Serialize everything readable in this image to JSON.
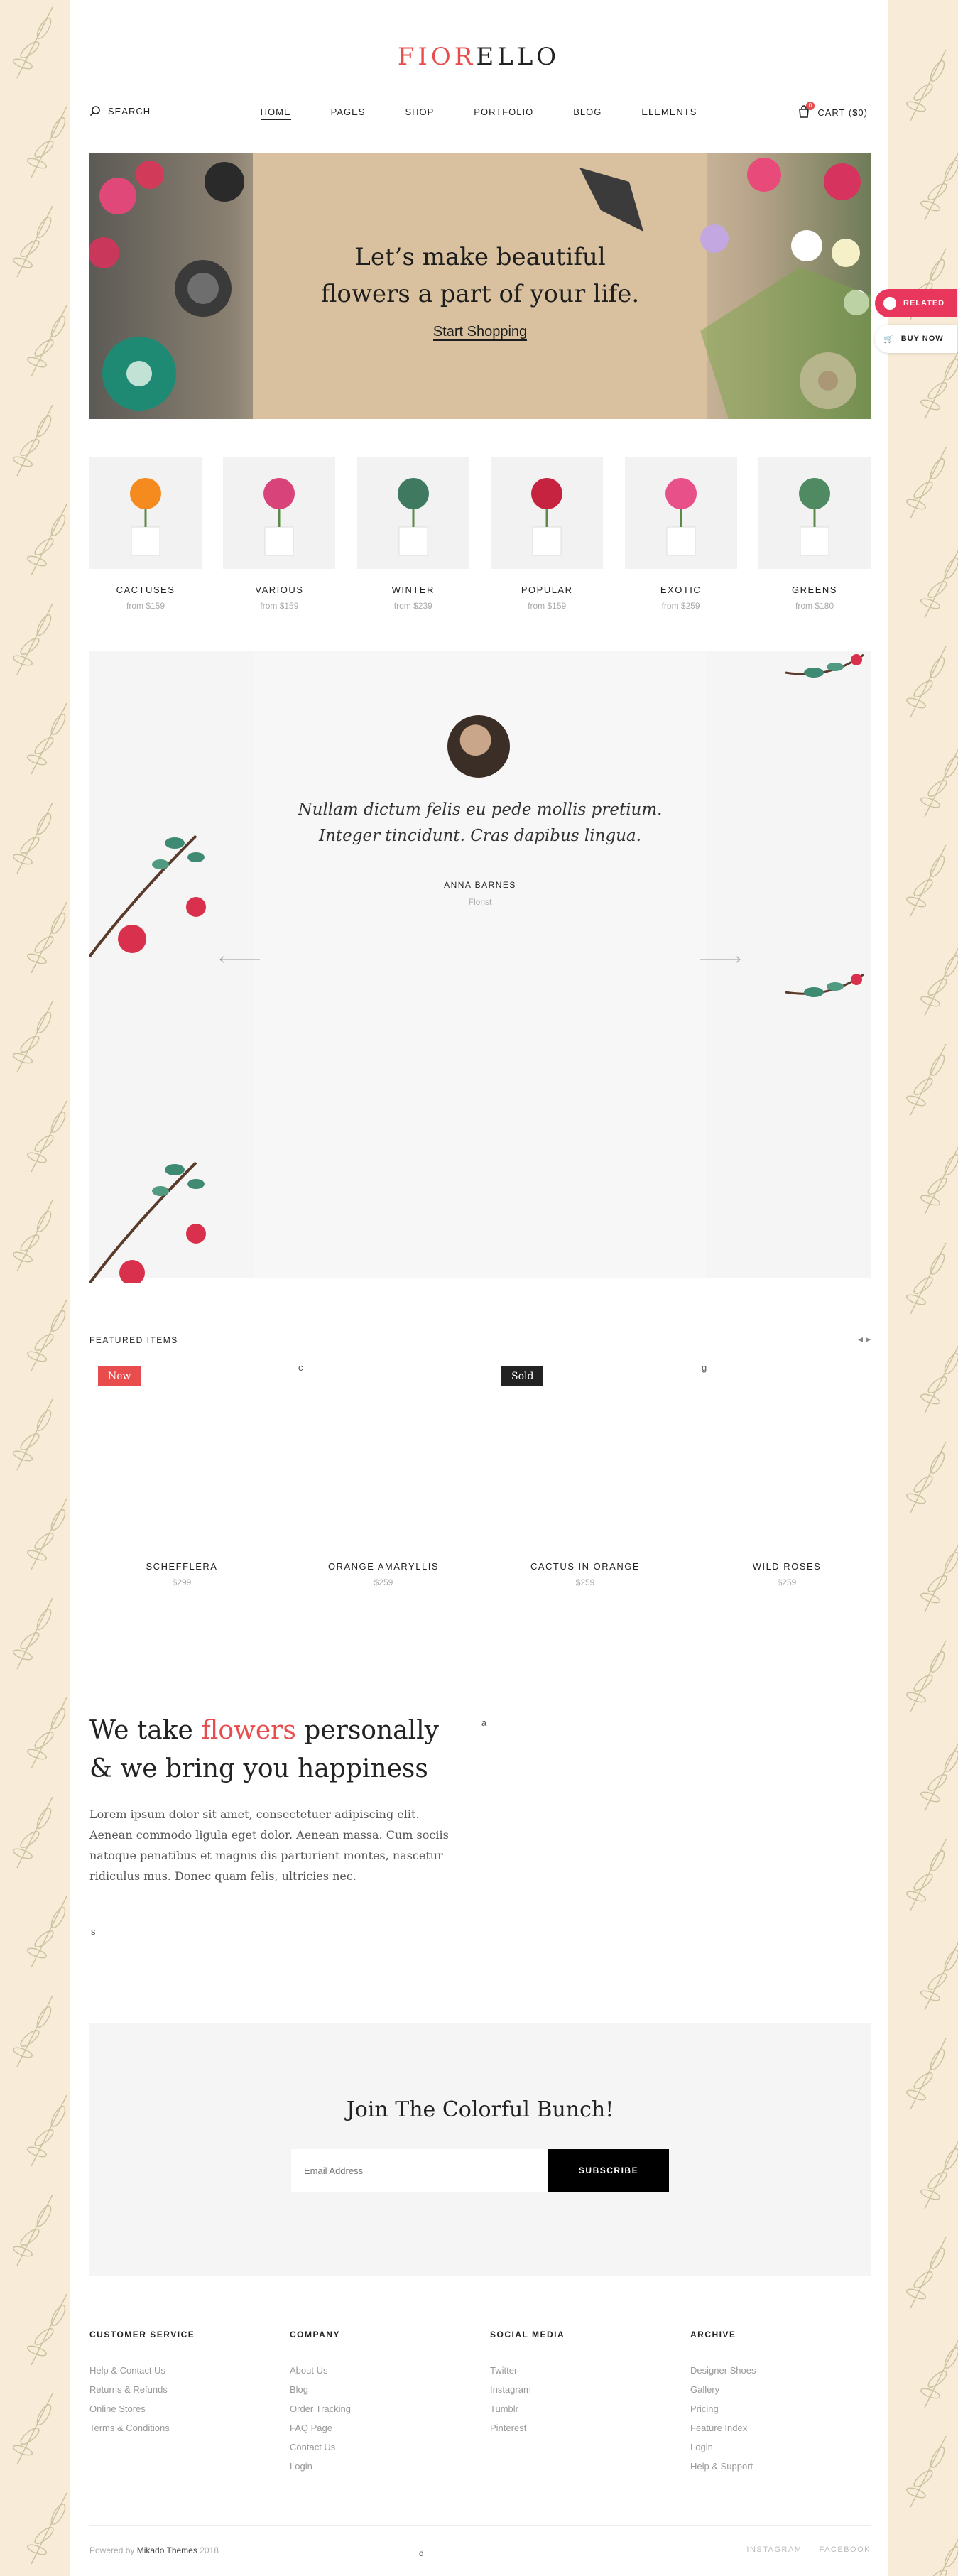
{
  "logo": {
    "part1": "FIOR",
    "part2": "ELLO"
  },
  "nav": {
    "search_label": "SEARCH",
    "items": [
      "HOME",
      "PAGES",
      "SHOP",
      "PORTFOLIO",
      "BLOG",
      "ELEMENTS"
    ],
    "active": "HOME",
    "cart_label": "CART ($0)",
    "cart_count": "0"
  },
  "hero": {
    "line1": "Let’s make beautiful",
    "line2": "flowers a part of your life.",
    "cta": "Start Shopping"
  },
  "side_tabs": {
    "related": "RELATED",
    "buy": "BUY NOW"
  },
  "categories": [
    {
      "name": "CACTUSES",
      "price": "from $159"
    },
    {
      "name": "VARIOUS",
      "price": "from $159"
    },
    {
      "name": "WINTER",
      "price": "from $239"
    },
    {
      "name": "POPULAR",
      "price": "from $159"
    },
    {
      "name": "EXOTIC",
      "price": "from $259"
    },
    {
      "name": "GREENS",
      "price": "from $180"
    }
  ],
  "testimonial": {
    "quote_line1": "Nullam dictum felis eu pede mollis pretium.",
    "quote_line2": "Integer tincidunt. Cras dapibus lingua.",
    "author": "ANNA BARNES",
    "role": "Florist"
  },
  "featured": {
    "title": "FEATURED ITEMS",
    "products": [
      {
        "letter": "",
        "badge": "New",
        "name": "SCHEFFLERA",
        "price": "$299"
      },
      {
        "letter": "c",
        "badge": "",
        "name": "ORANGE AMARYLLIS",
        "price": "$259"
      },
      {
        "letter": "",
        "badge": "Sold",
        "name": "CACTUS IN ORANGE",
        "price": "$259"
      },
      {
        "letter": "g",
        "badge": "",
        "name": "WILD ROSES",
        "price": "$259"
      }
    ]
  },
  "about": {
    "h_part1": "We take ",
    "h_red": "flowers",
    "h_part2": " personally",
    "h_line2": "& we bring you happiness",
    "body": "Lorem ipsum dolor sit amet, consectetuer adipiscing elit. Aenean commodo ligula eget dolor. Aenean massa. Cum sociis natoque penatibus et magnis dis parturient montes, nascetur ridiculus mus. Donec quam felis, ultricies nec.",
    "img_letter": "a",
    "small_letter": "s"
  },
  "newsletter": {
    "title": "Join The Colorful Bunch!",
    "placeholder": "Email Address",
    "button": "SUBSCRIBE"
  },
  "footer": {
    "columns": [
      {
        "title": "CUSTOMER SERVICE",
        "links": [
          "Help & Contact Us",
          "Returns & Refunds",
          "Online Stores",
          "Terms & Conditions"
        ]
      },
      {
        "title": "COMPANY",
        "links": [
          "About Us",
          "Blog",
          "Order Tracking",
          "FAQ Page",
          "Contact Us",
          "Login"
        ]
      },
      {
        "title": "SOCIAL MEDIA",
        "links": [
          "Twitter",
          "Instagram",
          "Tumblr",
          "Pinterest"
        ]
      },
      {
        "title": "ARCHIVE",
        "links": [
          "Designer Shoes",
          "Gallery",
          "Pricing",
          "Feature Index",
          "Login",
          "Help & Support"
        ]
      }
    ],
    "powered_prefix": "Powered by ",
    "powered_brand": "Mikado Themes",
    "powered_year": " 2018",
    "mid_letter": "d",
    "social": [
      "INSTAGRAM",
      "FACEBOOK"
    ]
  },
  "colors": {
    "accent": "#e84c4c",
    "background": "#f8ecd8",
    "pink": "#e8365d"
  }
}
